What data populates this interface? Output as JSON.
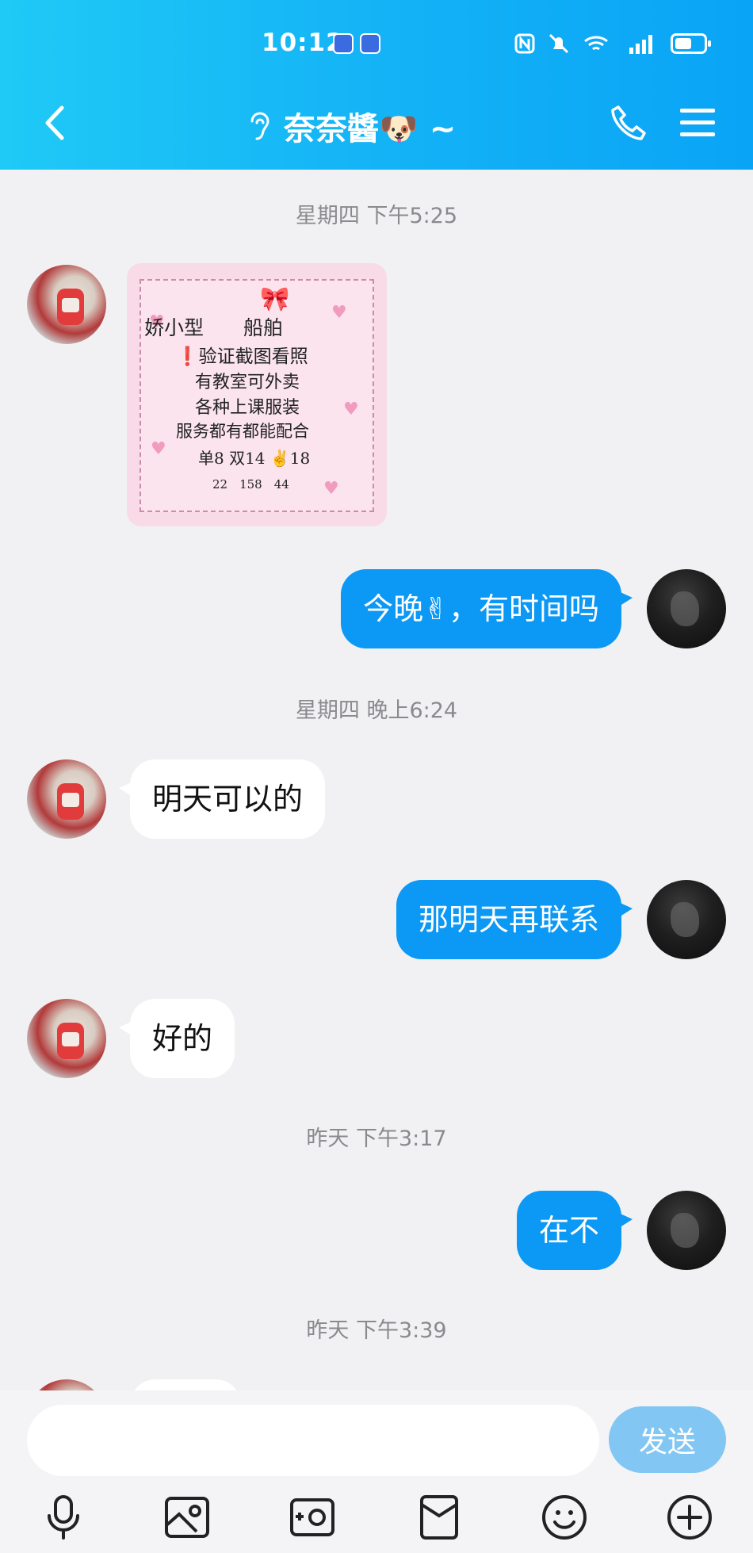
{
  "status_bar": {
    "time": "10:12"
  },
  "header": {
    "title": "奈奈醬🐶 ~"
  },
  "chat": {
    "timestamps": [
      "星期四 下午5:25",
      "星期四 晚上6:24",
      "昨天 下午3:17",
      "昨天 下午3:39"
    ],
    "image_card": {
      "lines": [
        "娇小型　　船舶",
        "❗验证截图看照",
        "有教室可外卖",
        "各种上课服装",
        "服务都有都能配合",
        "单8 双14 ✌18",
        "22　158　44"
      ]
    },
    "messages": [
      {
        "from": "me",
        "text": "今晚✌，有时间吗"
      },
      {
        "from": "her",
        "text": "明天可以的"
      },
      {
        "from": "me",
        "text": "那明天再联系"
      },
      {
        "from": "her",
        "text": "好的"
      },
      {
        "from": "me",
        "text": "在不"
      }
    ]
  },
  "input": {
    "value": "",
    "placeholder": "",
    "send_label": "发送"
  },
  "toolbar": {
    "icons": [
      "microphone-icon",
      "image-icon",
      "camera-icon",
      "red-packet-icon",
      "emoji-icon",
      "plus-icon"
    ]
  },
  "colors": {
    "header_start": "#1fcaf6",
    "header_end": "#0aa4f6",
    "bubble_out": "#0c98f5",
    "bubble_in": "#ffffff",
    "send_button": "#82c6f3"
  }
}
